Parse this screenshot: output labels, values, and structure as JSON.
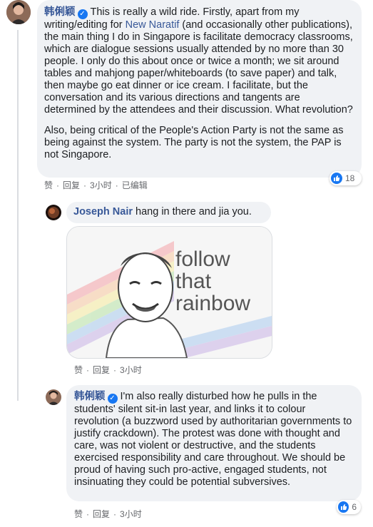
{
  "comment1": {
    "author": "韩俐颖",
    "text_before_link": "This is really a wild ride. Firstly, apart from my writing/editing for ",
    "link_text": "New Naratif",
    "text_after_link": " (and occasionally other publications), the main thing I do in Singapore is facilitate democracy classrooms, which are dialogue sessions usually attended by no more than 30 people. I only do this about once or twice a month; we sit around tables and mahjong paper/whiteboards (to save paper) and talk, then maybe go eat dinner or ice cream. I facilitate, but the conversation and its various directions and tangents are determined by the attendees and their discussion. What revolution?",
    "paragraph2": "Also, being critical of the People's Action Party is not the same as being against the system. The party is not the system, the PAP is not Singapore.",
    "like_label": "赞",
    "reply_label": "回复",
    "time": "3小时",
    "edited": "已编辑",
    "reaction_count": "18"
  },
  "reply1": {
    "author": "Joseph Nair",
    "text": "hang in there and jia you.",
    "image_text": "follow\nthat\nrainbow",
    "like_label": "赞",
    "reply_label": "回复",
    "time": "3小时"
  },
  "reply2": {
    "author": "韩俐颖",
    "text": "I'm also really disturbed how he pulls in the students' silent sit-in last year, and links it to colour revolution (a buzzword used by authoritarian governments to justify crackdown). The protest was done with thought and care, was not violent or destructive, and the students exercised responsibility and care throughout. We should be proud of having such pro-active, engaged students, not insinuating they could be potential subversives.",
    "like_label": "赞",
    "reply_label": "回复",
    "time": "3小时",
    "reaction_count": "6"
  },
  "colors": {
    "link": "#385898",
    "bubble": "#f0f2f5",
    "like_blue": "#1877f2",
    "meta": "#65676b"
  }
}
